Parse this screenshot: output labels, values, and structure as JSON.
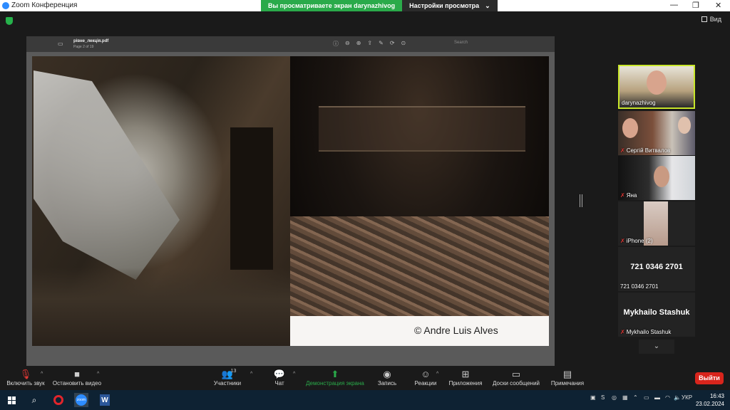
{
  "window": {
    "title": "Zoom Конференция",
    "share_banner": "Вы просматриваете экран darynazhivog",
    "view_options": "Настройки просмотра",
    "view_options_chevron": "⌄",
    "minimize": "—",
    "maximize": "❐",
    "close": "✕"
  },
  "top": {
    "view_label": "Вид"
  },
  "pdf": {
    "filename": "рівне_лекція.pdf",
    "page_info": "Page 2 of 19",
    "search_placeholder": "Search"
  },
  "slide": {
    "credit": "© Andre Luis Alves"
  },
  "participants": [
    {
      "name": "darynazhivog",
      "muted": false
    },
    {
      "name": "Сергій Витвалов",
      "muted": true
    },
    {
      "name": "Яна",
      "muted": true
    },
    {
      "name": "iPhone (2)",
      "muted": true
    },
    {
      "name": "721 0346 2701",
      "display": "721 0346 2701",
      "muted": false
    },
    {
      "name": "Mykhailo Stashuk",
      "display": "Mykhailo Stashuk",
      "muted": true
    }
  ],
  "panel": {
    "scroll_down": "⌄"
  },
  "toolbar": {
    "unmute": "Включить звук",
    "stop_video": "Остановить видео",
    "participants": "Участники",
    "participants_count": "13",
    "chat": "Чат",
    "share_screen": "Демонстрация экрана",
    "record": "Запись",
    "reactions": "Реакции",
    "apps": "Приложения",
    "whiteboards": "Доски сообщений",
    "notes": "Примечания",
    "leave": "Выйти",
    "caret": "^"
  },
  "taskbar": {
    "zoom_label": "zoom",
    "word_label": "W",
    "language": "УКР",
    "time": "16:43",
    "date": "23.02.2024"
  },
  "colors": {
    "accent_green": "#2aaa4a",
    "leave_red": "#d9251c",
    "active_border": "#c8e62a",
    "zoom_blue": "#2d8cff"
  }
}
